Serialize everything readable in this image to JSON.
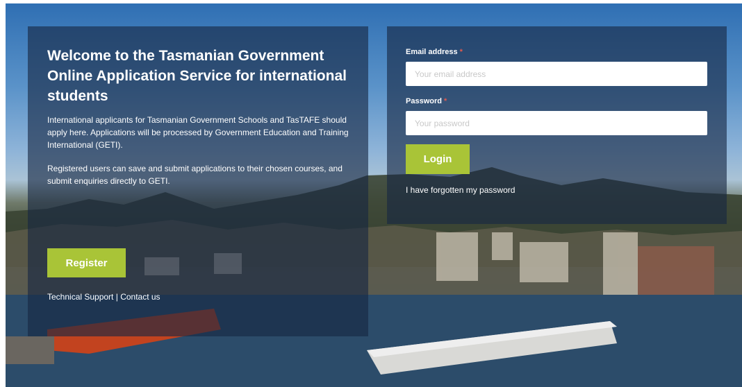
{
  "intro": {
    "title": "Welcome to the Tasmanian Government Online Application Service for international students",
    "paragraph1": "International applicants for Tasmanian Government Schools and TasTAFE should apply here. Applications will be processed by Government Education and Training International (GETI).",
    "paragraph2": "Registered users can save and submit applications to their chosen courses, and submit enquiries directly to GETI.",
    "register_label": "Register",
    "technical_support": "Technical Support",
    "separator": " | ",
    "contact_us": "Contact us"
  },
  "login": {
    "email_label": "Email address",
    "email_placeholder": "Your email address",
    "password_label": "Password",
    "password_placeholder": "Your password",
    "required_marker": "*",
    "login_label": "Login",
    "forgot_label": "I have forgotten my password"
  },
  "colors": {
    "accent": "#a9c437",
    "panel": "#162642",
    "required": "#e05a4f"
  }
}
